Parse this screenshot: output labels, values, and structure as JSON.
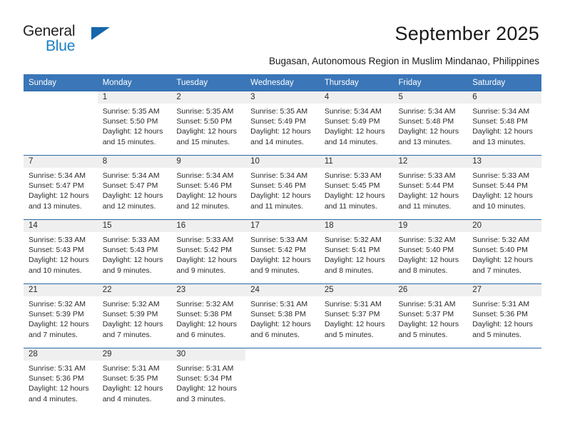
{
  "brand": {
    "name_top": "General",
    "name_bottom": "Blue",
    "triangle_color": "#1566ab",
    "text_color": "#231f20",
    "blue_color": "#1b7fc4"
  },
  "header": {
    "title": "September 2025",
    "subtitle": "Bugasan, Autonomous Region in Muslim Mindanao, Philippines"
  },
  "calendar": {
    "header_bg": "#3a76b8",
    "row_border": "#2a68a8",
    "daynum_bg": "#efefef",
    "weekdays": [
      "Sunday",
      "Monday",
      "Tuesday",
      "Wednesday",
      "Thursday",
      "Friday",
      "Saturday"
    ],
    "weeks": [
      [
        {
          "day": "",
          "sunrise": "",
          "sunset": "",
          "daylight_line1": "",
          "daylight_line2": ""
        },
        {
          "day": "1",
          "sunrise": "Sunrise: 5:35 AM",
          "sunset": "Sunset: 5:50 PM",
          "daylight_line1": "Daylight: 12 hours",
          "daylight_line2": "and 15 minutes."
        },
        {
          "day": "2",
          "sunrise": "Sunrise: 5:35 AM",
          "sunset": "Sunset: 5:50 PM",
          "daylight_line1": "Daylight: 12 hours",
          "daylight_line2": "and 15 minutes."
        },
        {
          "day": "3",
          "sunrise": "Sunrise: 5:35 AM",
          "sunset": "Sunset: 5:49 PM",
          "daylight_line1": "Daylight: 12 hours",
          "daylight_line2": "and 14 minutes."
        },
        {
          "day": "4",
          "sunrise": "Sunrise: 5:34 AM",
          "sunset": "Sunset: 5:49 PM",
          "daylight_line1": "Daylight: 12 hours",
          "daylight_line2": "and 14 minutes."
        },
        {
          "day": "5",
          "sunrise": "Sunrise: 5:34 AM",
          "sunset": "Sunset: 5:48 PM",
          "daylight_line1": "Daylight: 12 hours",
          "daylight_line2": "and 13 minutes."
        },
        {
          "day": "6",
          "sunrise": "Sunrise: 5:34 AM",
          "sunset": "Sunset: 5:48 PM",
          "daylight_line1": "Daylight: 12 hours",
          "daylight_line2": "and 13 minutes."
        }
      ],
      [
        {
          "day": "7",
          "sunrise": "Sunrise: 5:34 AM",
          "sunset": "Sunset: 5:47 PM",
          "daylight_line1": "Daylight: 12 hours",
          "daylight_line2": "and 13 minutes."
        },
        {
          "day": "8",
          "sunrise": "Sunrise: 5:34 AM",
          "sunset": "Sunset: 5:47 PM",
          "daylight_line1": "Daylight: 12 hours",
          "daylight_line2": "and 12 minutes."
        },
        {
          "day": "9",
          "sunrise": "Sunrise: 5:34 AM",
          "sunset": "Sunset: 5:46 PM",
          "daylight_line1": "Daylight: 12 hours",
          "daylight_line2": "and 12 minutes."
        },
        {
          "day": "10",
          "sunrise": "Sunrise: 5:34 AM",
          "sunset": "Sunset: 5:46 PM",
          "daylight_line1": "Daylight: 12 hours",
          "daylight_line2": "and 11 minutes."
        },
        {
          "day": "11",
          "sunrise": "Sunrise: 5:33 AM",
          "sunset": "Sunset: 5:45 PM",
          "daylight_line1": "Daylight: 12 hours",
          "daylight_line2": "and 11 minutes."
        },
        {
          "day": "12",
          "sunrise": "Sunrise: 5:33 AM",
          "sunset": "Sunset: 5:44 PM",
          "daylight_line1": "Daylight: 12 hours",
          "daylight_line2": "and 11 minutes."
        },
        {
          "day": "13",
          "sunrise": "Sunrise: 5:33 AM",
          "sunset": "Sunset: 5:44 PM",
          "daylight_line1": "Daylight: 12 hours",
          "daylight_line2": "and 10 minutes."
        }
      ],
      [
        {
          "day": "14",
          "sunrise": "Sunrise: 5:33 AM",
          "sunset": "Sunset: 5:43 PM",
          "daylight_line1": "Daylight: 12 hours",
          "daylight_line2": "and 10 minutes."
        },
        {
          "day": "15",
          "sunrise": "Sunrise: 5:33 AM",
          "sunset": "Sunset: 5:43 PM",
          "daylight_line1": "Daylight: 12 hours",
          "daylight_line2": "and 9 minutes."
        },
        {
          "day": "16",
          "sunrise": "Sunrise: 5:33 AM",
          "sunset": "Sunset: 5:42 PM",
          "daylight_line1": "Daylight: 12 hours",
          "daylight_line2": "and 9 minutes."
        },
        {
          "day": "17",
          "sunrise": "Sunrise: 5:33 AM",
          "sunset": "Sunset: 5:42 PM",
          "daylight_line1": "Daylight: 12 hours",
          "daylight_line2": "and 9 minutes."
        },
        {
          "day": "18",
          "sunrise": "Sunrise: 5:32 AM",
          "sunset": "Sunset: 5:41 PM",
          "daylight_line1": "Daylight: 12 hours",
          "daylight_line2": "and 8 minutes."
        },
        {
          "day": "19",
          "sunrise": "Sunrise: 5:32 AM",
          "sunset": "Sunset: 5:40 PM",
          "daylight_line1": "Daylight: 12 hours",
          "daylight_line2": "and 8 minutes."
        },
        {
          "day": "20",
          "sunrise": "Sunrise: 5:32 AM",
          "sunset": "Sunset: 5:40 PM",
          "daylight_line1": "Daylight: 12 hours",
          "daylight_line2": "and 7 minutes."
        }
      ],
      [
        {
          "day": "21",
          "sunrise": "Sunrise: 5:32 AM",
          "sunset": "Sunset: 5:39 PM",
          "daylight_line1": "Daylight: 12 hours",
          "daylight_line2": "and 7 minutes."
        },
        {
          "day": "22",
          "sunrise": "Sunrise: 5:32 AM",
          "sunset": "Sunset: 5:39 PM",
          "daylight_line1": "Daylight: 12 hours",
          "daylight_line2": "and 7 minutes."
        },
        {
          "day": "23",
          "sunrise": "Sunrise: 5:32 AM",
          "sunset": "Sunset: 5:38 PM",
          "daylight_line1": "Daylight: 12 hours",
          "daylight_line2": "and 6 minutes."
        },
        {
          "day": "24",
          "sunrise": "Sunrise: 5:31 AM",
          "sunset": "Sunset: 5:38 PM",
          "daylight_line1": "Daylight: 12 hours",
          "daylight_line2": "and 6 minutes."
        },
        {
          "day": "25",
          "sunrise": "Sunrise: 5:31 AM",
          "sunset": "Sunset: 5:37 PM",
          "daylight_line1": "Daylight: 12 hours",
          "daylight_line2": "and 5 minutes."
        },
        {
          "day": "26",
          "sunrise": "Sunrise: 5:31 AM",
          "sunset": "Sunset: 5:37 PM",
          "daylight_line1": "Daylight: 12 hours",
          "daylight_line2": "and 5 minutes."
        },
        {
          "day": "27",
          "sunrise": "Sunrise: 5:31 AM",
          "sunset": "Sunset: 5:36 PM",
          "daylight_line1": "Daylight: 12 hours",
          "daylight_line2": "and 5 minutes."
        }
      ],
      [
        {
          "day": "28",
          "sunrise": "Sunrise: 5:31 AM",
          "sunset": "Sunset: 5:36 PM",
          "daylight_line1": "Daylight: 12 hours",
          "daylight_line2": "and 4 minutes."
        },
        {
          "day": "29",
          "sunrise": "Sunrise: 5:31 AM",
          "sunset": "Sunset: 5:35 PM",
          "daylight_line1": "Daylight: 12 hours",
          "daylight_line2": "and 4 minutes."
        },
        {
          "day": "30",
          "sunrise": "Sunrise: 5:31 AM",
          "sunset": "Sunset: 5:34 PM",
          "daylight_line1": "Daylight: 12 hours",
          "daylight_line2": "and 3 minutes."
        },
        {
          "day": "",
          "sunrise": "",
          "sunset": "",
          "daylight_line1": "",
          "daylight_line2": ""
        },
        {
          "day": "",
          "sunrise": "",
          "sunset": "",
          "daylight_line1": "",
          "daylight_line2": ""
        },
        {
          "day": "",
          "sunrise": "",
          "sunset": "",
          "daylight_line1": "",
          "daylight_line2": ""
        },
        {
          "day": "",
          "sunrise": "",
          "sunset": "",
          "daylight_line1": "",
          "daylight_line2": ""
        }
      ]
    ]
  }
}
